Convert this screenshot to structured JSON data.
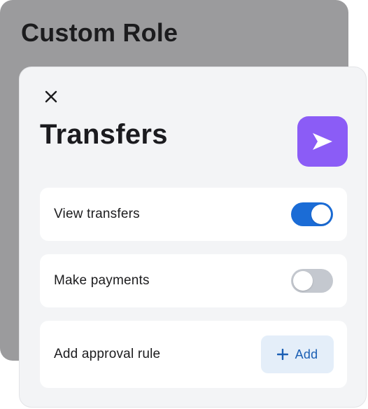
{
  "background_card": {
    "title": "Custom Role"
  },
  "modal": {
    "title": "Transfers",
    "close_icon": "close-icon",
    "app_icon": "send-icon",
    "app_icon_color": "#8b5cf6",
    "rows": [
      {
        "label": "View transfers",
        "control": "toggle",
        "checked": true
      },
      {
        "label": "Make payments",
        "control": "toggle",
        "checked": false
      },
      {
        "label": "Add approval rule",
        "control": "button",
        "button_label": "Add",
        "button_icon": "plus-icon"
      }
    ]
  },
  "colors": {
    "toggle_on": "#1b6cd6",
    "toggle_off": "#c4c8cf",
    "add_button_bg": "#e4eef9",
    "add_button_text": "#1b5fb4"
  }
}
